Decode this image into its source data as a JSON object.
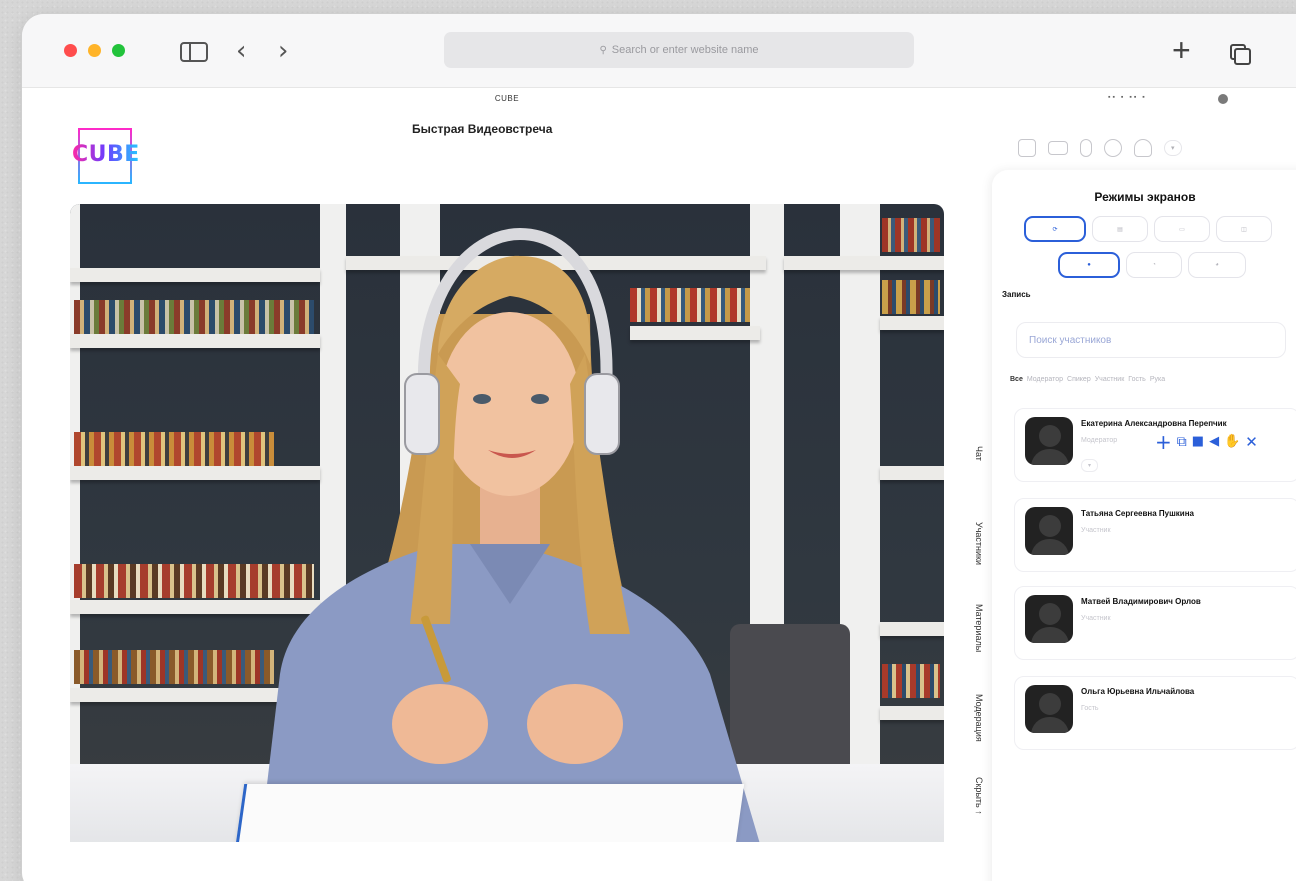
{
  "browser": {
    "address_placeholder": "Search or enter website name"
  },
  "page": {
    "site_title": "CUBE",
    "meeting_title": "Быстрая Видеовстреча"
  },
  "logo": {
    "main": "CUBE"
  },
  "tabs": [
    {
      "label": "Чат"
    },
    {
      "label": "Участники"
    },
    {
      "label": "Материалы"
    },
    {
      "label": "Модерация"
    },
    {
      "label": "Скрыть ↑"
    }
  ],
  "panel": {
    "title": "Режимы экранов",
    "record_label": "Запись",
    "search_placeholder": "Поиск участников",
    "filters": [
      "Все",
      "Модератор",
      "Спикер",
      "Участник",
      "Гость",
      "Рука"
    ],
    "participants": [
      {
        "name": "Екатерина Александровна Перепчик",
        "role": "Модератор"
      },
      {
        "name": "Татьяна Сергеевна Пушкина",
        "role": "Участник"
      },
      {
        "name": "Матвей Владимирович Орлов",
        "role": "Участник"
      },
      {
        "name": "Ольга Юрьевна Ильчайлова",
        "role": "Гость"
      }
    ]
  },
  "colors": {
    "accent": "#2b5fd9",
    "traffic_red": "#ff4d4d",
    "traffic_yellow": "#ffb429",
    "traffic_green": "#22c33b"
  }
}
